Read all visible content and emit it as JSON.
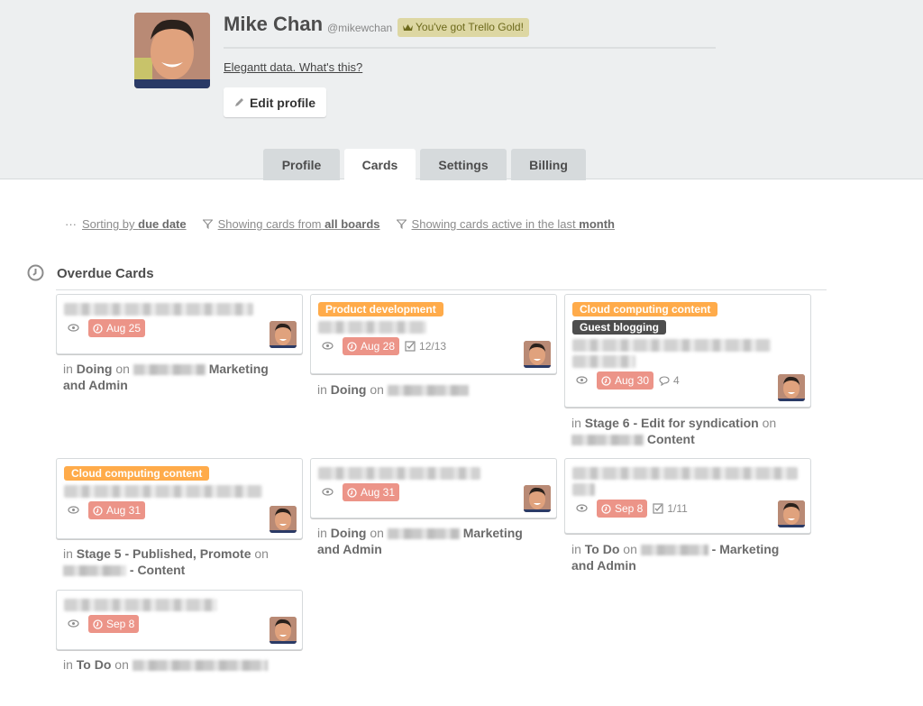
{
  "profile": {
    "name": "Mike Chan",
    "username": "@mikewchan",
    "gold_badge": "You've got Trello Gold!",
    "elegantt_link": "Elegantt data. What's this?",
    "edit_button": "Edit profile"
  },
  "tabs": [
    {
      "label": "Profile",
      "active": false
    },
    {
      "label": "Cards",
      "active": true
    },
    {
      "label": "Settings",
      "active": false
    },
    {
      "label": "Billing",
      "active": false
    }
  ],
  "filters": {
    "sort_prefix": "Sorting by ",
    "sort_value": "due date",
    "boards_prefix": "Showing cards from ",
    "boards_value": "all boards",
    "active_prefix": "Showing cards active in the last ",
    "active_value": "month"
  },
  "section": {
    "title": "Overdue Cards"
  },
  "cards": [
    {
      "labels": [],
      "due": "Aug 25",
      "checklist": null,
      "comments": null,
      "loc_in": "in ",
      "list": "Doing",
      "loc_on": " on ",
      "board_suffix": "Marketing and Admin"
    },
    {
      "labels": [
        {
          "text": "Product development",
          "color": "#ffab4a"
        }
      ],
      "due": "Aug 28",
      "checklist": "12/13",
      "comments": null,
      "loc_in": "in ",
      "list": "Doing",
      "loc_on": " on ",
      "board_suffix": ""
    },
    {
      "labels": [
        {
          "text": "Cloud computing content",
          "color": "#ffab4a"
        },
        {
          "text": "Guest blogging",
          "color": "#4d4d4d"
        }
      ],
      "due": "Aug 30",
      "checklist": null,
      "comments": "4",
      "loc_in": "in ",
      "list": "Stage 6 - Edit for syndication",
      "loc_on": " on ",
      "board_suffix": "Content"
    },
    {
      "labels": [
        {
          "text": "Cloud computing content",
          "color": "#ffab4a"
        }
      ],
      "due": "Aug 31",
      "checklist": null,
      "comments": null,
      "loc_in": "in ",
      "list": "Stage 5 - Published, Promote",
      "loc_on": " on ",
      "board_suffix": "- Content"
    },
    {
      "labels": [],
      "due": "Aug 31",
      "checklist": null,
      "comments": null,
      "loc_in": "in ",
      "list": "Doing",
      "loc_on": " on ",
      "board_suffix": "Marketing and Admin"
    },
    {
      "labels": [],
      "due": "Sep 8",
      "checklist": "1/11",
      "comments": null,
      "loc_in": "in ",
      "list": "To Do",
      "loc_on": " on ",
      "board_suffix": "- Marketing and Admin"
    },
    {
      "labels": [],
      "due": "Sep 8",
      "checklist": null,
      "comments": null,
      "loc_in": "in ",
      "list": "To Do",
      "loc_on": " on ",
      "board_suffix": ""
    }
  ],
  "colors": {
    "due_overdue": "#ec9488",
    "label_orange": "#ffab4a",
    "label_dark": "#4d4d4d",
    "gold_bg": "#ddd7a3"
  }
}
